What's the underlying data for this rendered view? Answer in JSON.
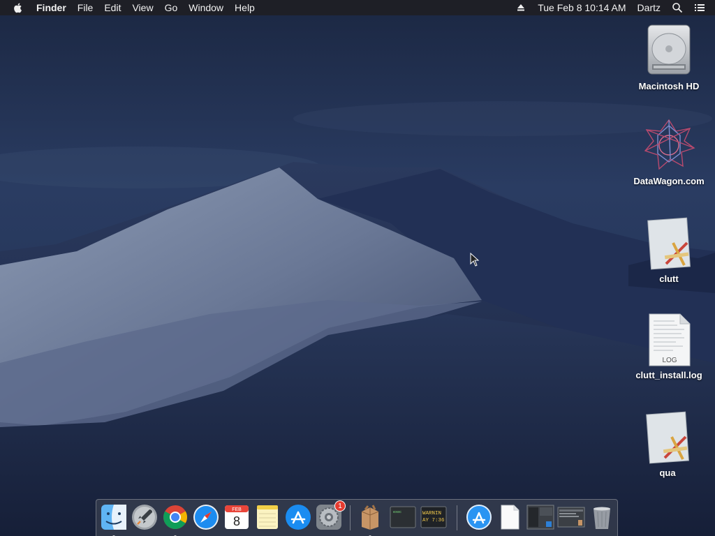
{
  "menubar": {
    "app_name": "Finder",
    "menus": [
      "File",
      "Edit",
      "View",
      "Go",
      "Window",
      "Help"
    ],
    "datetime": "Tue Feb 8  10:14 AM",
    "user": "Dartz"
  },
  "desktop_icons": [
    {
      "label": "Macintosh HD",
      "icon": "hard-drive-icon"
    },
    {
      "label": "DataWagon.com",
      "icon": "network-volume-icon"
    },
    {
      "label": "clutt",
      "icon": "app-script-icon"
    },
    {
      "label": "clutt_install.log",
      "icon": "log-file-icon",
      "badge": "LOG"
    },
    {
      "label": "qua",
      "icon": "app-script-icon"
    }
  ],
  "dock": {
    "calendar_month": "FEB",
    "calendar_day": "8",
    "settings_badge": "1",
    "terminal_thumb_text": "exec",
    "console_thumb_line1": "WARNIN",
    "console_thumb_line2": "AY 7:36",
    "items": [
      "Finder",
      "Launchpad",
      "Google Chrome",
      "Safari",
      "Calendar",
      "Notes",
      "App Store",
      "System Preferences",
      "Installer Package",
      "Terminal",
      "Console",
      "Applications",
      "Document",
      "Screenshot 1",
      "Screenshot 2",
      "Trash"
    ]
  }
}
